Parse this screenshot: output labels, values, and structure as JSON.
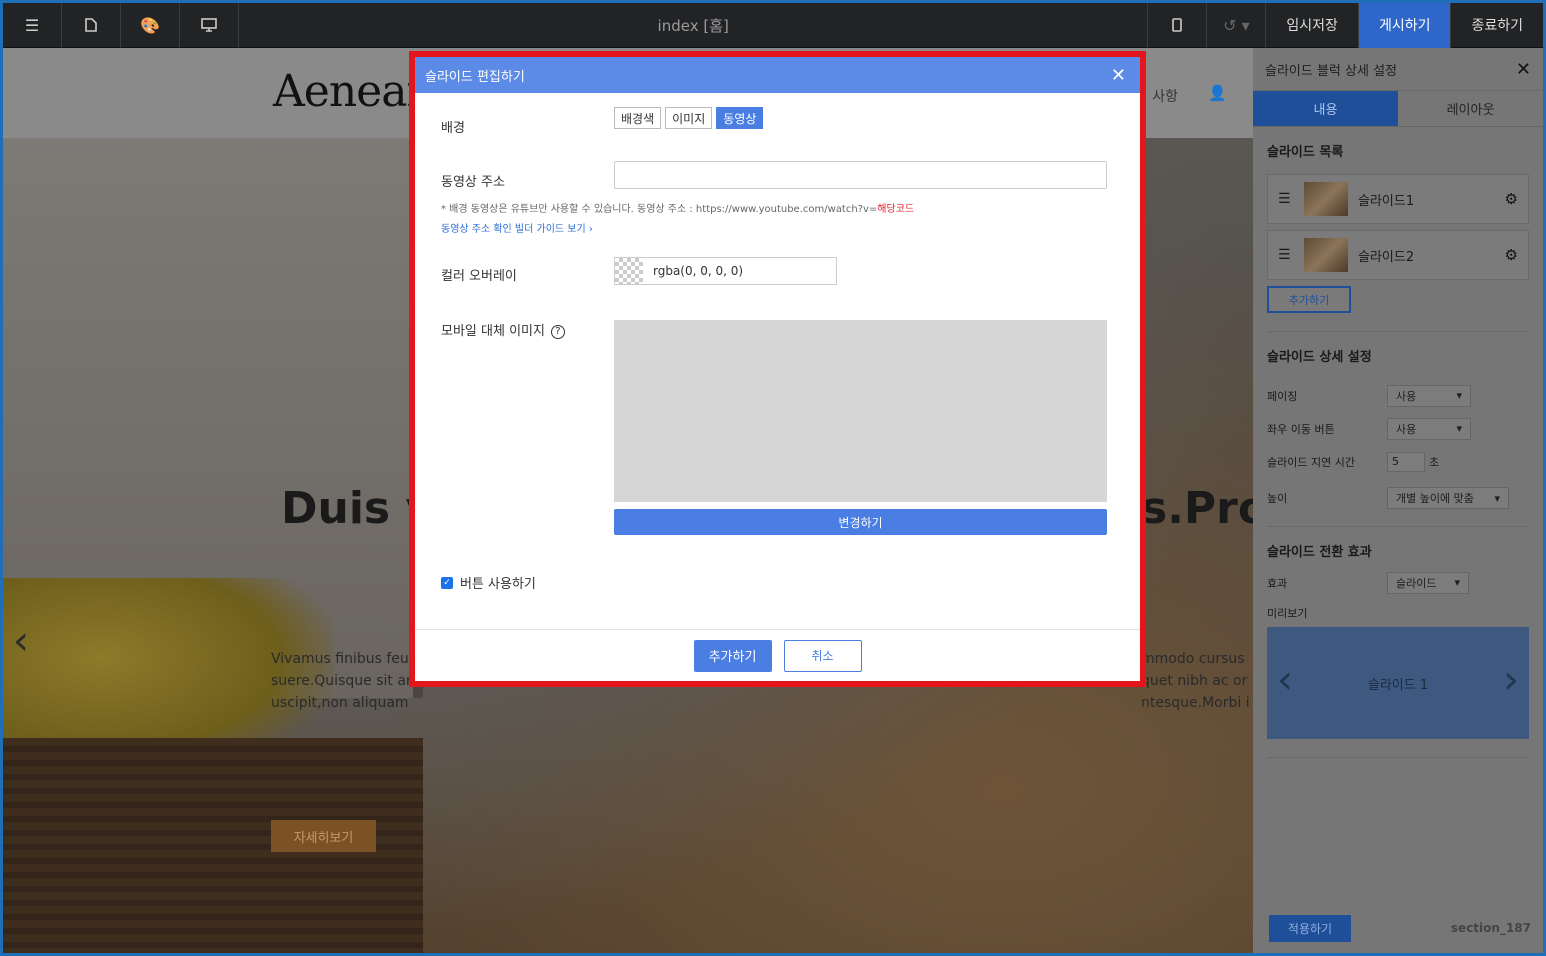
{
  "topbar": {
    "title": "index [홈]",
    "save_label": "임시저장",
    "publish_label": "게시하기",
    "exit_label": "종료하기"
  },
  "site": {
    "logo": "Aenean",
    "nav_item": "사항",
    "hero_title_left": "Duis v",
    "hero_title_right": "s.Pro",
    "hero_text_left_1": "Vivamus finibus feu",
    "hero_text_left_2": "suere.Quisque sit ar",
    "hero_text_left_3": "uscipit,non aliquam",
    "hero_text_right_1": "mmodo cursus",
    "hero_text_right_2": "quet nibh ac or",
    "hero_text_right_3": "ntesque.Morbi i",
    "hero_button": "자세히보기"
  },
  "panel": {
    "title": "슬라이드 블럭 상세 설정",
    "tabs": [
      {
        "label": "내용"
      },
      {
        "label": "레이아웃"
      }
    ],
    "slides_title": "슬라이드 목록",
    "slides": [
      {
        "label": "슬라이드1"
      },
      {
        "label": "슬라이드2"
      }
    ],
    "add_label": "추가하기",
    "detail_title": "슬라이드 상세 설정",
    "paging_label": "페이징",
    "paging_value": "사용",
    "arrows_label": "좌우 이동 버튼",
    "arrows_value": "사용",
    "delay_label": "슬라이드 지연 시간",
    "delay_value": "5",
    "delay_unit": "초",
    "height_label": "높이",
    "height_value": "개별 높이에 맞춤",
    "transition_title": "슬라이드 전환 효과",
    "effect_label": "효과",
    "effect_value": "슬라이드",
    "preview_label": "미리보기",
    "preview_slide": "슬라이드 1",
    "apply_label": "적용하기",
    "section_id": "section_187"
  },
  "modal": {
    "title": "슬라이드 편집하기",
    "bg_label": "배경",
    "bg_options": [
      {
        "label": "배경색"
      },
      {
        "label": "이미지"
      },
      {
        "label": "동영상"
      }
    ],
    "video_url_label": "동영상 주소",
    "video_url_value": "",
    "hint_text": "* 배경 동영상은 유튜브만 사용할 수 있습니다. 동영상 주소 : https://www.youtube.com/watch?v=",
    "hint_code": "해당코드",
    "hint_link": "동영상 주소 확인 빌더 가이드 보기 ›",
    "overlay_label": "컬러 오버레이",
    "overlay_value": "rgba(0, 0, 0, 0)",
    "mobile_label": "모바일 대체 이미지",
    "change_label": "변경하기",
    "use_button_label": "버튼 사용하기",
    "use_button_checked": true,
    "add_label": "추가하기",
    "cancel_label": "취소"
  },
  "colors": {
    "accent": "#4a7ee3",
    "modal_header": "#5b8be6",
    "highlight_outline": "#e5161b",
    "hint_red": "#e0202a"
  }
}
